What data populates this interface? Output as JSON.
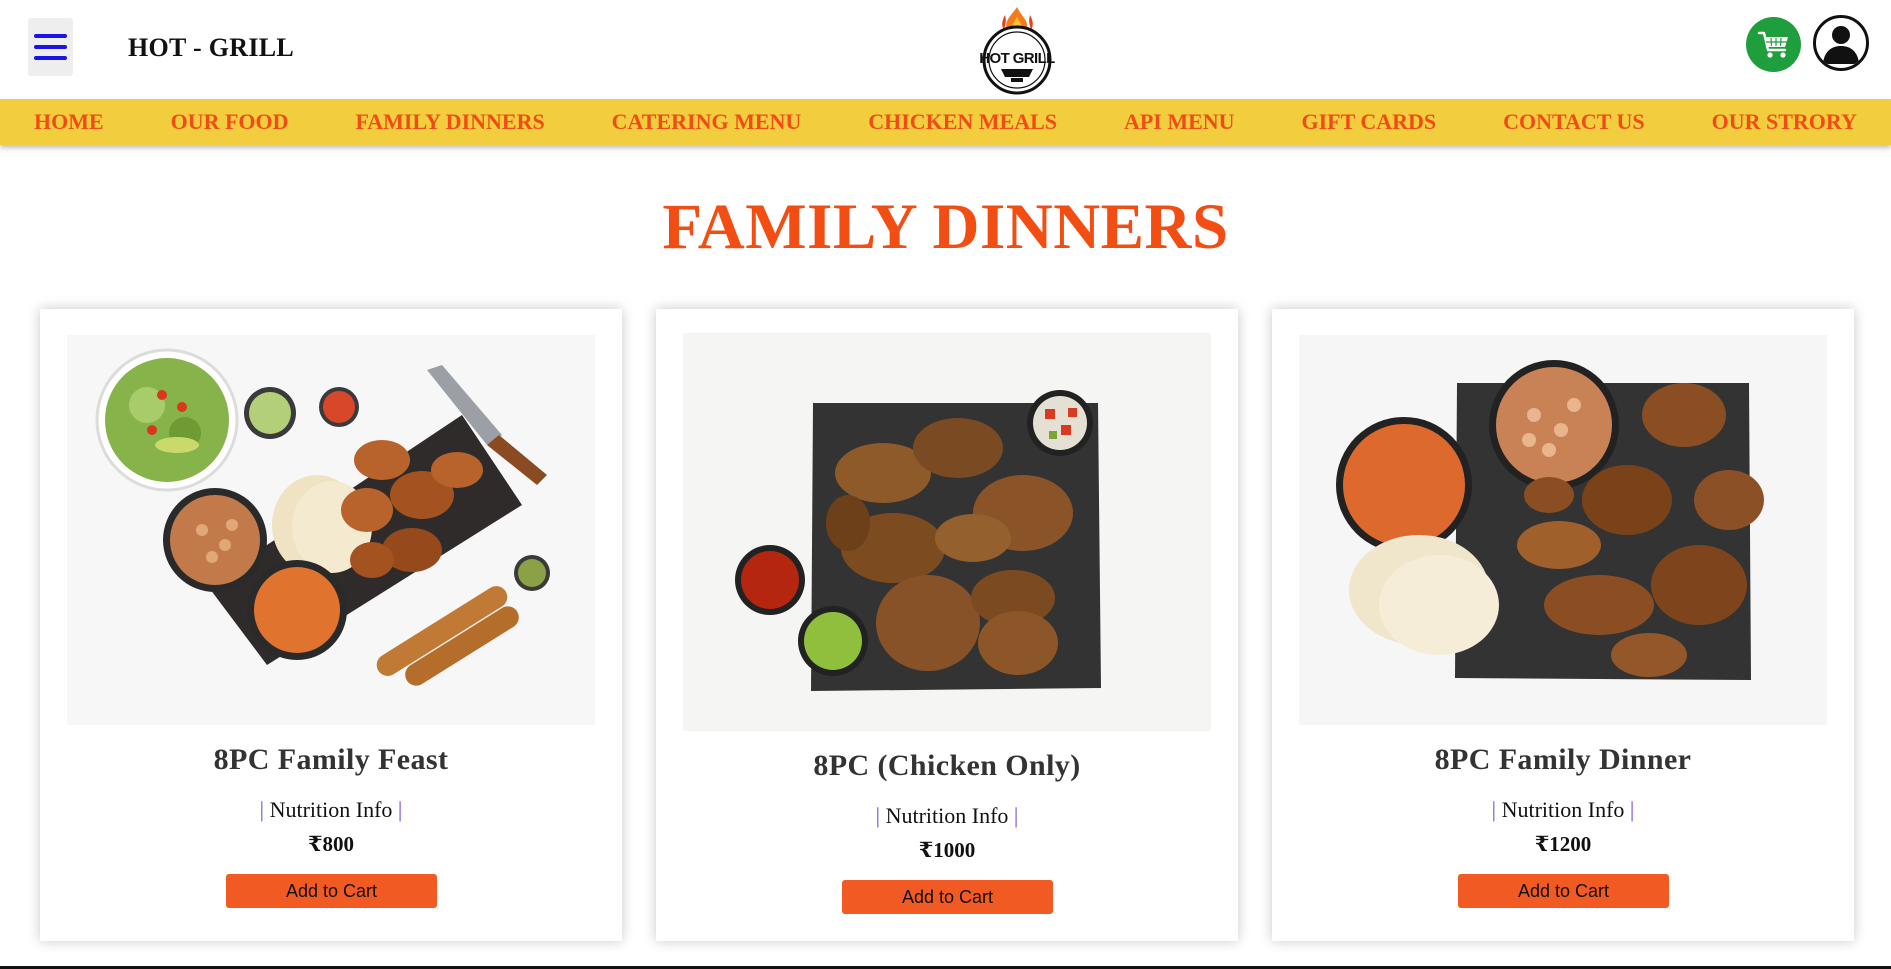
{
  "header": {
    "brand": "HOT - GRILL",
    "logo_text": "HOT GRILL",
    "menu_icon": "hamburger-menu-icon",
    "cart_icon": "shopping-cart-icon",
    "profile_icon": "user-profile-icon"
  },
  "nav": {
    "items": [
      {
        "label": "HOME"
      },
      {
        "label": "OUR FOOD"
      },
      {
        "label": "FAMILY DINNERS"
      },
      {
        "label": "CATERING MENU"
      },
      {
        "label": "CHICKEN MEALS"
      },
      {
        "label": "API MENU"
      },
      {
        "label": "GIFT CARDS"
      },
      {
        "label": "CONTACT US"
      },
      {
        "label": "OUR STRORY"
      }
    ]
  },
  "page": {
    "title": "FAMILY DINNERS"
  },
  "products": [
    {
      "name": "8PC Family Feast",
      "nutrition_label": "Nutrition Info",
      "price": "₹800",
      "button": "Add to Cart"
    },
    {
      "name": "8PC (Chicken Only)",
      "nutrition_label": "Nutrition Info",
      "price": "₹1000",
      "button": "Add to Cart"
    },
    {
      "name": "8PC Family Dinner",
      "nutrition_label": "Nutrition Info",
      "price": "₹1200",
      "button": "Add to Cart"
    }
  ],
  "colors": {
    "accent": "#f24e14",
    "nav_bg": "#f2cd3e",
    "button_bg": "#f15a22",
    "cart_bg": "#1f9e3d",
    "menu_icon": "#1a12e6"
  }
}
